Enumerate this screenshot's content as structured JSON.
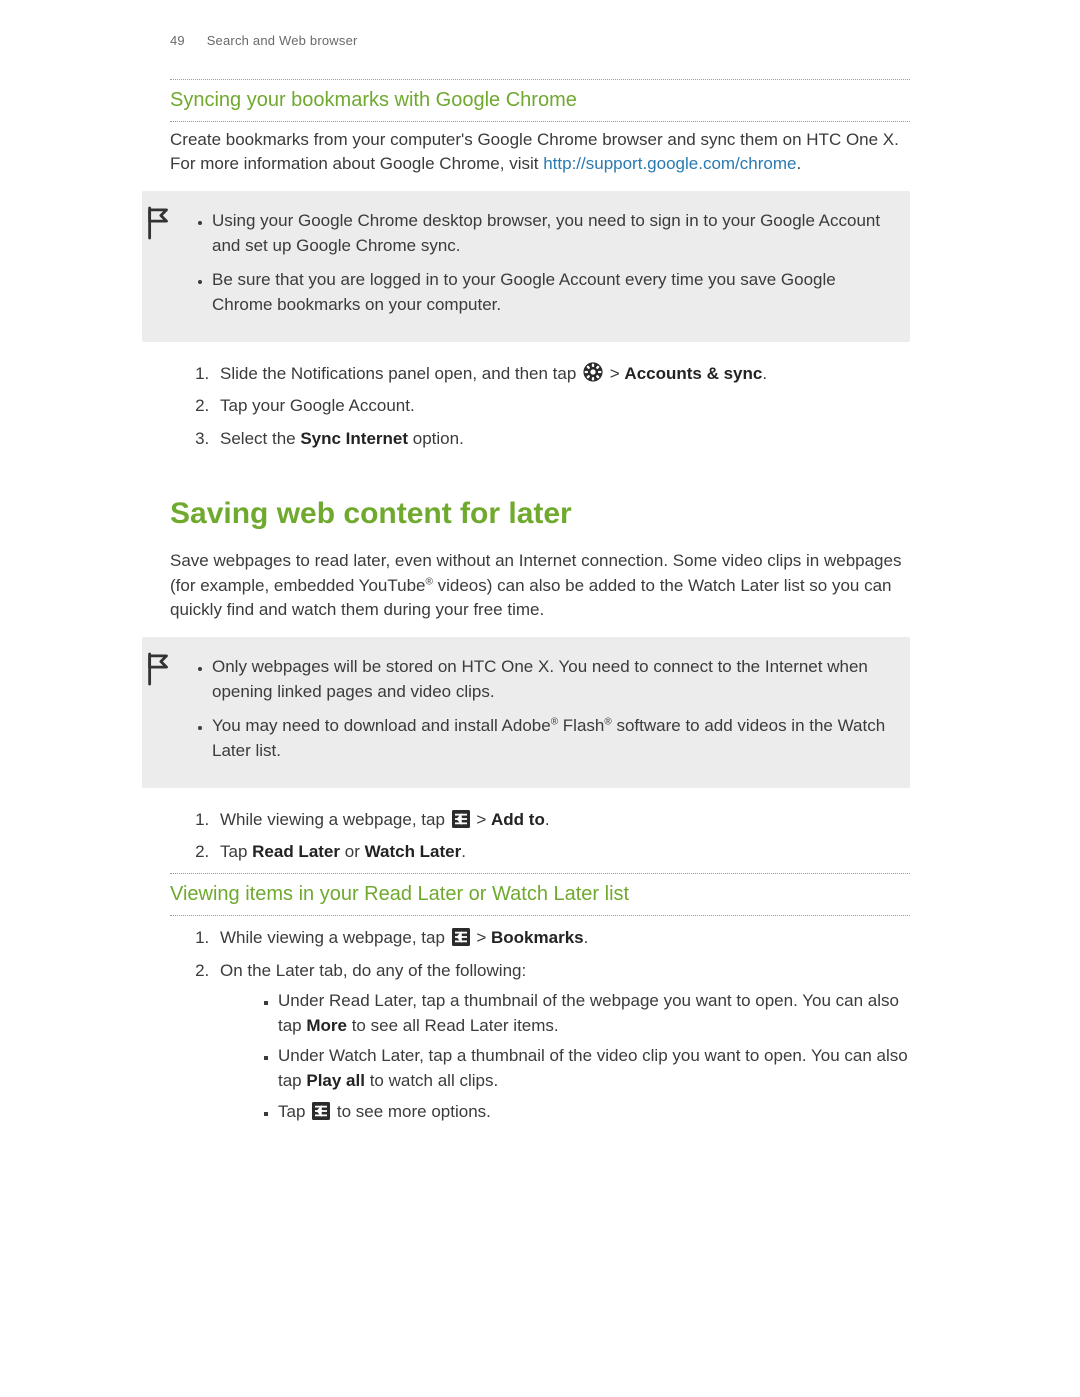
{
  "header": {
    "page_num": "49",
    "section": "Search and Web browser"
  },
  "sync": {
    "title": "Syncing your bookmarks with Google Chrome",
    "intro_a": "Create bookmarks from your computer's Google Chrome browser and sync them on HTC One X. For more information about Google Chrome, visit ",
    "link_text": "http://support.google.com/chrome",
    "intro_b": ".",
    "note1": "Using your Google Chrome desktop browser, you need to sign in to your Google Account and set up Google Chrome sync.",
    "note2": "Be sure that you are logged in to your Google Account every time you save Google Chrome bookmarks on your computer.",
    "step1_a": "Slide the Notifications panel open, and then tap ",
    "step1_b": " > ",
    "step1_bold": "Accounts & sync",
    "step1_c": ".",
    "step2": "Tap your Google Account.",
    "step3_a": "Select the ",
    "step3_bold": "Sync Internet",
    "step3_b": " option."
  },
  "saving": {
    "title": "Saving web content for later",
    "intro_a": "Save webpages to read later, even without an Internet connection. Some video clips in webpages (for example, embedded YouTube",
    "intro_b": " videos) can also be added to the Watch Later list so you can quickly find and watch them during your free time.",
    "note1": "Only webpages will be stored on HTC One X. You need to connect to the Internet when opening linked pages and video clips.",
    "note2_a": "You may need to download and install Adobe",
    "note2_b": " Flash",
    "note2_c": " software to add videos in the Watch Later list.",
    "step1_a": "While viewing a webpage, tap ",
    "step1_b": " > ",
    "step1_bold": "Add to",
    "step1_c": ".",
    "step2_a": "Tap ",
    "step2_bold1": "Read Later",
    "step2_b": " or ",
    "step2_bold2": "Watch Later",
    "step2_c": "."
  },
  "viewing": {
    "title": "Viewing items in your Read Later or Watch Later list",
    "step1_a": "While viewing a webpage, tap ",
    "step1_b": " > ",
    "step1_bold": "Bookmarks",
    "step1_c": ".",
    "step2": "On the Later tab, do any of the following:",
    "sub1_a": "Under Read Later, tap a thumbnail of the webpage you want to open. You can also tap ",
    "sub1_bold": "More",
    "sub1_b": " to see all Read Later items.",
    "sub2_a": "Under Watch Later, tap a thumbnail of the video clip you want to open. You can also tap ",
    "sub2_bold": "Play all",
    "sub2_b": " to watch all clips.",
    "sub3_a": "Tap ",
    "sub3_b": " to see more options."
  },
  "glyphs": {
    "reg": "®"
  }
}
